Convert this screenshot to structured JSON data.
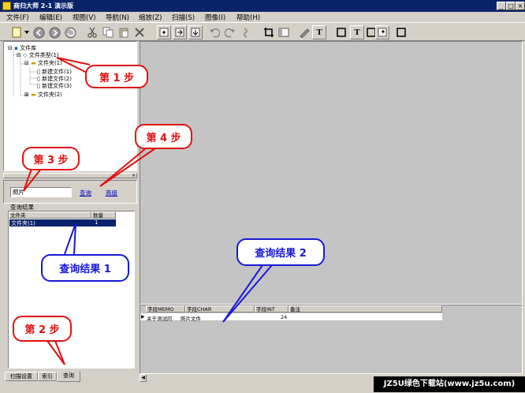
{
  "window": {
    "title": "商归大师 2-1 演示版"
  },
  "menu": [
    "文件(F)",
    "编辑(E)",
    "视图(V)",
    "导航(N)",
    "缩放(Z)",
    "扫描(S)",
    "图像(I)",
    "帮助(H)"
  ],
  "toolbar_icons": [
    "new-icon",
    "dropdown-icon",
    "back-icon",
    "forward-icon",
    "refresh-icon",
    "cut-icon",
    "copy-icon",
    "paste-icon",
    "delete-icon",
    "insert-icon",
    "import-icon",
    "export-icon",
    "undo-icon",
    "redo-icon",
    "link-icon",
    "crop-icon",
    "frame-icon",
    "pen-icon",
    "text-icon",
    "rect-icon",
    "text-box-icon",
    "rect2-icon",
    "picture-icon",
    "square-icon"
  ],
  "tree": {
    "root": "文件库",
    "types": "文件类型(1)",
    "folder1": "文件夹(1)",
    "files": [
      "新建文件(1)",
      "新建文件(2)",
      "新建文件(3)"
    ],
    "folder2": "文件夹(2)"
  },
  "search": {
    "input_value": "照片",
    "query_link": "查询",
    "advanced_link": "高级",
    "results_label": "查询结果",
    "columns": [
      "文件夹",
      "数量"
    ],
    "rows": [
      {
        "folder": "文件夹(1)",
        "count": "1"
      }
    ]
  },
  "tabs": [
    "扫描设置",
    "索引",
    "查询"
  ],
  "grid": {
    "columns": [
      "字段MEMO",
      "字段CHAR",
      "字段INT",
      "备注"
    ],
    "rows": [
      {
        "memo": "关于测试的",
        "char": "照片文件",
        "int": "24",
        "note": ""
      }
    ]
  },
  "callouts": {
    "step1": "第 1 步",
    "step2": "第 2 步",
    "step3": "第 3 步",
    "step4": "第 4 步",
    "result1": "查询结果 1",
    "result2": "查询结果 2"
  },
  "watermark": "JZ5U绿色下载站(www.jz5u.com)",
  "colors": {
    "title_bar": "#0a246a",
    "callout_red": "#e01010",
    "callout_blue": "#1818d8",
    "selection": "#0a246a"
  }
}
